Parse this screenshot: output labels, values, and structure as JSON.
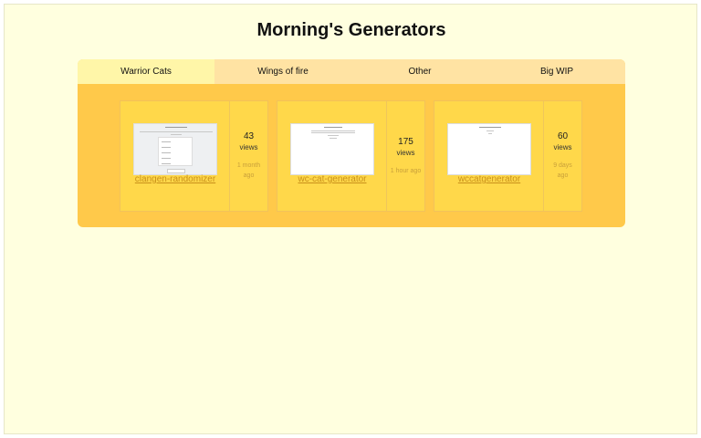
{
  "header": {
    "title": "Morning's Generators"
  },
  "tabs": [
    {
      "label": "Warrior Cats"
    },
    {
      "label": "Wings of fire"
    },
    {
      "label": "Other"
    },
    {
      "label": "Big WIP"
    }
  ],
  "cards": [
    {
      "name": "clangen-randomizer",
      "views": "43",
      "views_label": "views",
      "time": "1 month ago"
    },
    {
      "name": "wc-cat-generator",
      "views": "175",
      "views_label": "views",
      "time": "1 hour ago"
    },
    {
      "name": "wccatgenerator",
      "views": "60",
      "views_label": "views",
      "time": "9 days ago"
    }
  ],
  "colors": {
    "background": "#ffffdf",
    "panel": "#ffc94a",
    "card": "#ffd84a",
    "active_tab": "#fff6a8",
    "tab_bar": "#ffe3a3",
    "link": "#c8901a"
  }
}
